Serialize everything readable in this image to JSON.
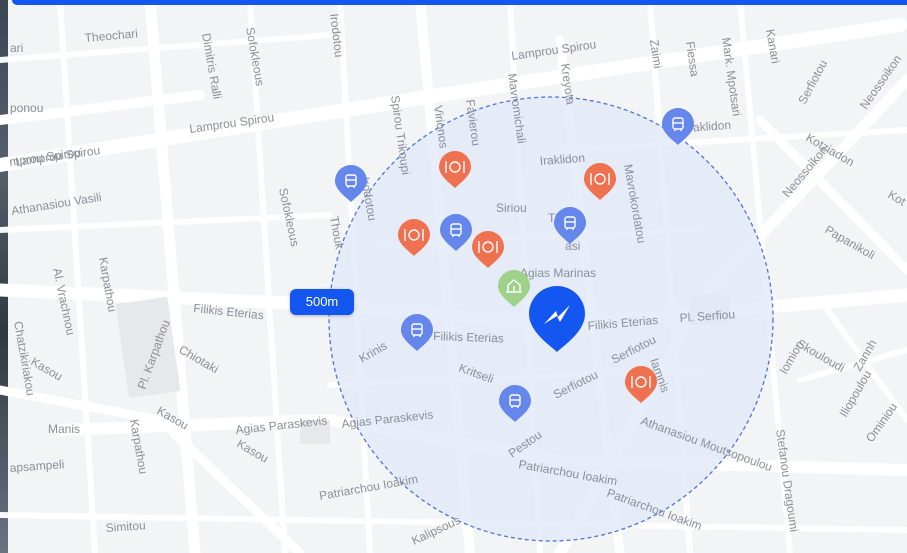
{
  "map": {
    "radius_label": "500m",
    "streets": [
      "Theochari",
      "Lamprou Spirou",
      "Lamprou Spirou",
      "Lamprou Spirou",
      "Dimitris Ralli",
      "Sofokleous",
      "Irodotou",
      "Irodotou",
      "Spirou Trikoupi",
      "Virionos",
      "Favierou",
      "Mavromichali",
      "Kreyota",
      "Zaimi",
      "Fiessa",
      "Mark. Mpotsari",
      "Kanari",
      "Serfiotou",
      "Neossoikon",
      "Iraklidon",
      "Iraklidon",
      "Kotziadon",
      "Kot",
      "Neossoikon",
      "Mavrokordatou",
      "Papanikoli",
      "Siriou",
      "Th",
      "asi",
      "Athanasiou Vasili",
      "Sofokleous",
      "Thouk",
      "Al. Vrachnou",
      "Karpathou",
      "Filikis Eterias",
      "Filikis Eterias",
      "Filikis Eterias",
      "Pl. Serfiou",
      "Agias Marinas",
      "Krinis",
      "Kritseli",
      "Serfiotou",
      "Serfiotou",
      "Iamnis",
      "Skouloudi",
      "Iomion",
      "Zannh",
      "Chatzikiriakou",
      "Kasou",
      "Chiotaki",
      "Pl. Karpathou",
      "Kasou",
      "Kasou",
      "Manis",
      "Karpathou",
      "Agias Paraskevis",
      "Agias Paraskevis",
      "Pestou",
      "Athanasiou Moutsopoulou",
      "Iliopoulou",
      "Ominiou",
      "Stefanou Dragoumi",
      "Patriarchou Ioakim",
      "Patriarchou Ioakim",
      "Patriarchou Ioakim",
      "apsampeli",
      "Simitou",
      "Kalipsous",
      "ari",
      "ponou",
      "mprou Spirou"
    ]
  },
  "pois": [
    {
      "type": "bus",
      "icon": "bus-icon",
      "color": "#6586ea"
    },
    {
      "type": "bus",
      "icon": "bus-icon",
      "color": "#6586ea"
    },
    {
      "type": "bus",
      "icon": "bus-icon",
      "color": "#6586ea"
    },
    {
      "type": "bus",
      "icon": "bus-icon",
      "color": "#6586ea"
    },
    {
      "type": "bus",
      "icon": "bus-icon",
      "color": "#6586ea"
    },
    {
      "type": "bus",
      "icon": "bus-icon",
      "color": "#6586ea"
    },
    {
      "type": "restaurant",
      "icon": "restaurant-icon",
      "color": "#ef7150"
    },
    {
      "type": "restaurant",
      "icon": "restaurant-icon",
      "color": "#ef7150"
    },
    {
      "type": "restaurant",
      "icon": "restaurant-icon",
      "color": "#ef7150"
    },
    {
      "type": "restaurant",
      "icon": "restaurant-icon",
      "color": "#ef7150"
    },
    {
      "type": "restaurant",
      "icon": "restaurant-icon",
      "color": "#ef7150"
    },
    {
      "type": "landmark",
      "icon": "landmark-icon",
      "color": "#9ed18a"
    }
  ],
  "center_marker": {
    "icon": "lightning-icon",
    "color": "#1456f0"
  },
  "colors": {
    "accent": "#1456f0",
    "circle_fill": "#e2e8f9",
    "circle_stroke": "#4c76d8"
  }
}
